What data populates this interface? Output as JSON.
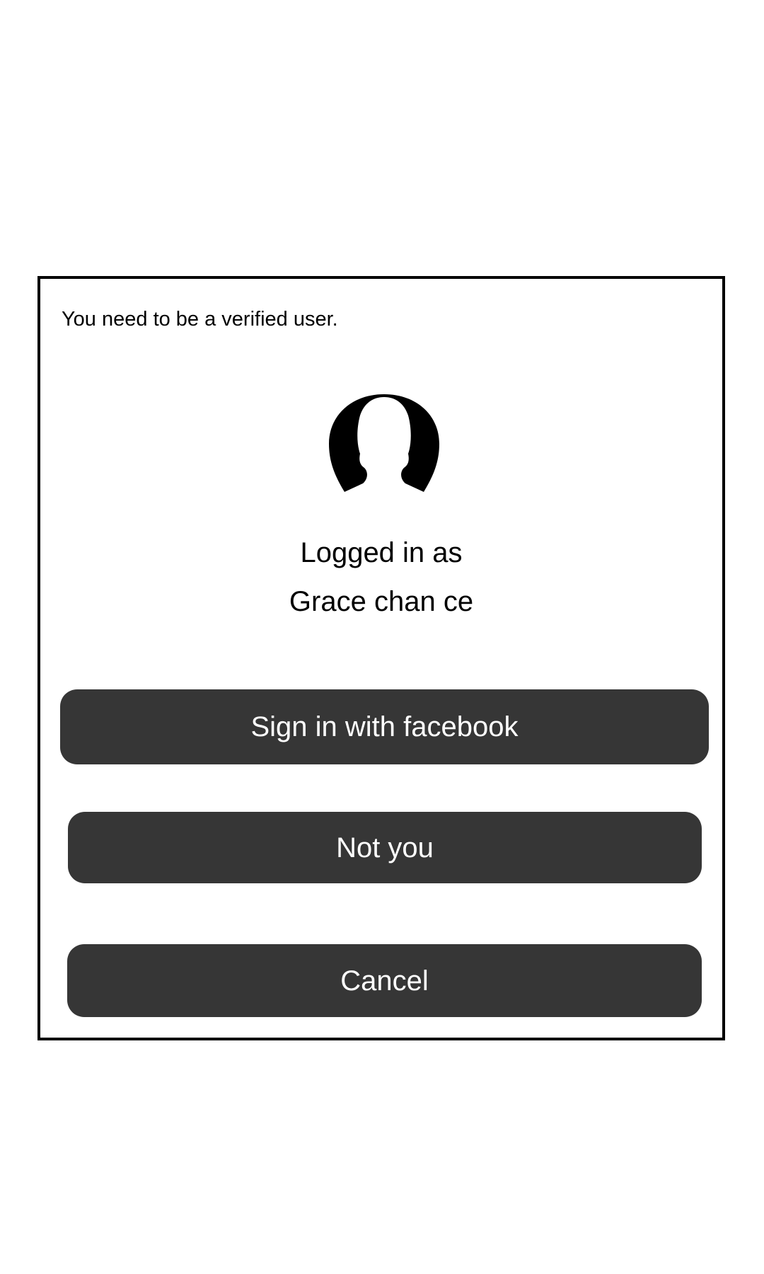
{
  "dialog": {
    "notice": "You need to be a verified user.",
    "avatar_icon": "user-silhouette-icon",
    "logged_in_label": "Logged in as",
    "user_name": "Grace chan ce",
    "buttons": {
      "facebook": "Sign in with facebook",
      "not_you": "Not you",
      "cancel": "Cancel"
    }
  },
  "colors": {
    "background": "#ffffff",
    "border": "#000000",
    "button_bg": "#363636",
    "button_text": "#ffffff"
  }
}
